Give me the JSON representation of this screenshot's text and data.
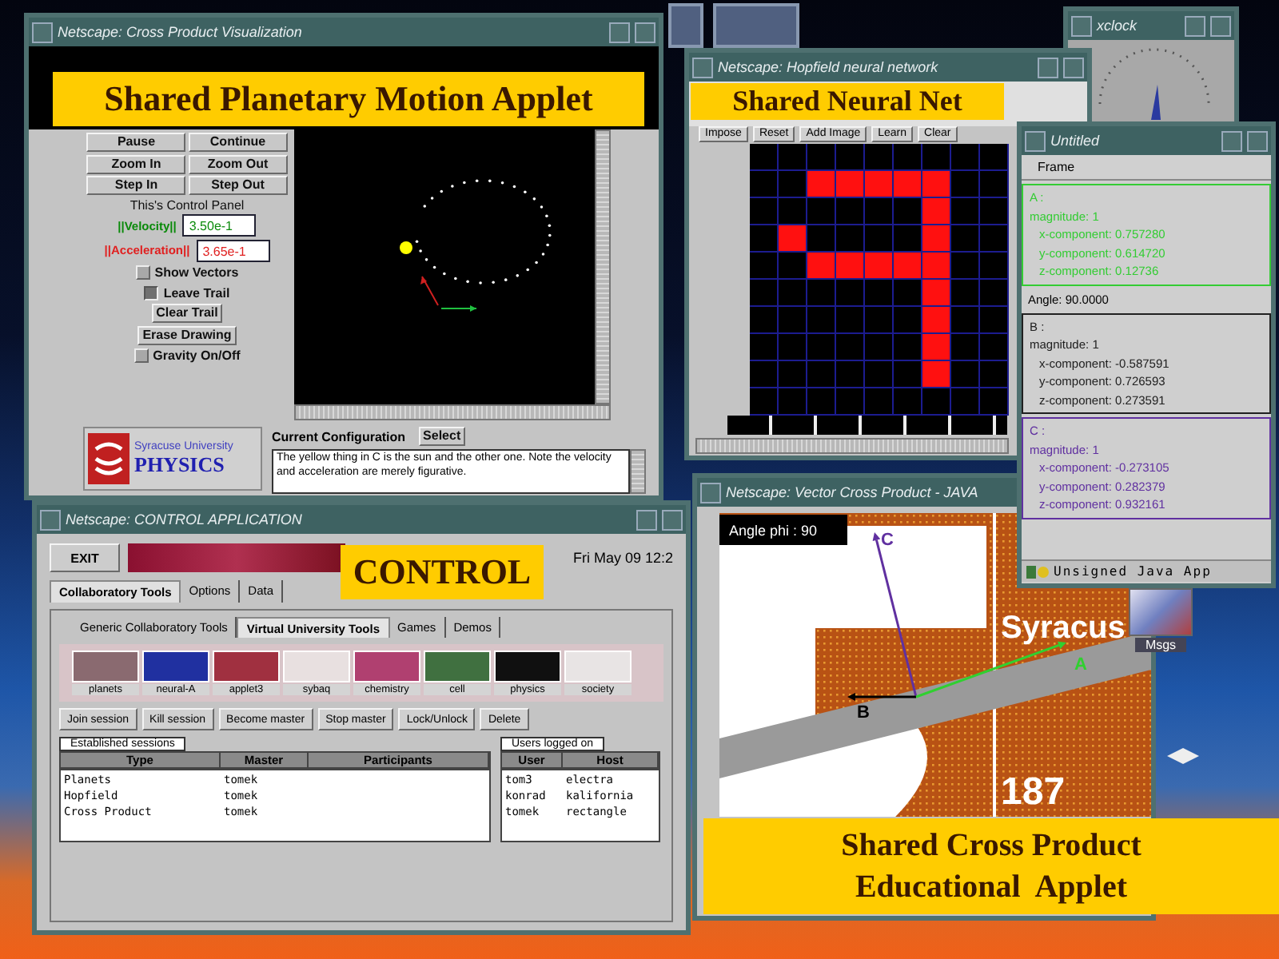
{
  "planetary_window": {
    "title": "Netscape: Cross Product Visualization",
    "banner": "Shared Planetary Motion Applet",
    "button_rows": [
      {
        "left": "Pause",
        "right": "Continue"
      },
      {
        "left": "Zoom In",
        "right": "Zoom Out"
      },
      {
        "left": "Step In",
        "right": "Step Out"
      }
    ],
    "panel_label": "This's Control Panel",
    "fields": [
      {
        "label": "||Velocity||",
        "value": "3.50e-1",
        "color": "#0a8a0a"
      },
      {
        "label": "||Acceleration||",
        "value": "3.65e-1",
        "color": "#e02020"
      }
    ],
    "options": [
      {
        "kind": "checkbox",
        "label": "Show Vectors",
        "checked": false
      },
      {
        "kind": "checkbox",
        "label": "Leave Trail",
        "checked": true
      },
      {
        "kind": "button",
        "label": "Clear Trail"
      },
      {
        "kind": "button",
        "label": "Erase Drawing"
      },
      {
        "kind": "checkbox",
        "label": "Gravity On/Off",
        "checked": false
      }
    ],
    "logo": {
      "line1": "Syracuse University",
      "line2": "PHYSICS"
    },
    "config_label": "Current Configuration",
    "select_button": "Select",
    "config_text": "The yellow thing in C is the sun and the other one. Note the velocity and acceleration are merely figurative."
  },
  "xclock_window": {
    "title": "xclock"
  },
  "neural_net_window": {
    "title": "Netscape: Hopfield neural network",
    "banner": "Shared Neural Net",
    "buttons": [
      "Impose",
      "Reset",
      "Add Image",
      "Learn",
      "Clear"
    ],
    "grid": [
      [
        false,
        false,
        false,
        false,
        false,
        false,
        false,
        false,
        false
      ],
      [
        false,
        false,
        true,
        true,
        true,
        true,
        true,
        false,
        false
      ],
      [
        false,
        false,
        false,
        false,
        false,
        false,
        true,
        false,
        false
      ],
      [
        false,
        true,
        false,
        false,
        false,
        false,
        true,
        false,
        false
      ],
      [
        false,
        false,
        true,
        true,
        true,
        true,
        true,
        false,
        false
      ],
      [
        false,
        false,
        false,
        false,
        false,
        false,
        true,
        false,
        false
      ],
      [
        false,
        false,
        false,
        false,
        false,
        false,
        true,
        false,
        false
      ],
      [
        false,
        false,
        false,
        false,
        false,
        false,
        true,
        false,
        false
      ],
      [
        false,
        false,
        false,
        false,
        false,
        false,
        true,
        false,
        false
      ],
      [
        false,
        false,
        false,
        false,
        false,
        false,
        false,
        false,
        false
      ]
    ]
  },
  "control_window": {
    "title": "Netscape: CONTROL APPLICATION",
    "banner": "CONTROL",
    "exit_button": "EXIT",
    "datetime": "Fri May 09 12:2",
    "tabs": [
      {
        "label": "Collaboratory Tools",
        "selected": true
      },
      {
        "label": "Options",
        "selected": false
      },
      {
        "label": "Data",
        "selected": false
      }
    ],
    "subtabs": [
      {
        "label": "Generic Collaboratory Tools",
        "selected": false
      },
      {
        "label": "Virtual University Tools",
        "selected": true
      },
      {
        "label": "Games",
        "selected": false
      },
      {
        "label": "Demos",
        "selected": false
      }
    ],
    "tools": [
      {
        "label": "planets",
        "color": "#8a6a70"
      },
      {
        "label": "neural-A",
        "color": "#2030a0"
      },
      {
        "label": "applet3",
        "color": "#a03040"
      },
      {
        "label": "sybaq",
        "color": "#e8e0e0"
      },
      {
        "label": "chemistry",
        "color": "#b04070"
      },
      {
        "label": "cell",
        "color": "#407040"
      },
      {
        "label": "physics",
        "color": "#101010"
      },
      {
        "label": "society",
        "color": "#e8e4e4"
      }
    ],
    "actions": [
      "Join session",
      "Kill session",
      "Become master",
      "Stop master",
      "Lock/Unlock",
      "Delete"
    ],
    "sessions_table": {
      "title": "Established sessions",
      "columns": [
        "Type",
        "Master",
        "Participants"
      ],
      "rows": [
        [
          "Planets",
          "tomek"
        ],
        [
          "Hopfield",
          "tomek"
        ],
        [
          "Cross Product",
          "tomek"
        ]
      ]
    },
    "users_table": {
      "title": "Users logged on",
      "columns": [
        "User",
        "Host"
      ],
      "rows": [
        [
          "tom3",
          "electra"
        ],
        [
          "konrad",
          "kalifornia"
        ],
        [
          "tomek",
          "rectangle"
        ]
      ]
    }
  },
  "cross_product_window": {
    "title": "Netscape: Vector Cross Product - JAVA",
    "banner_lines": [
      "Shared Cross Product",
      "Educational  Applet"
    ],
    "angle_label": "Angle phi : 90",
    "background_texts": [
      "Syracus",
      "187"
    ],
    "vectors": [
      {
        "label": "C",
        "color": "#6030a0"
      },
      {
        "label": "B",
        "color": "#000000"
      },
      {
        "label": "A",
        "color": "#30d030"
      }
    ]
  },
  "untitled_window": {
    "title": "Untitled",
    "menu": "Frame",
    "items": [
      {
        "kind": "vector",
        "color": "#33cc33",
        "lines": [
          "A :",
          "magnitude: 1",
          "x-component: 0.757280",
          "y-component: 0.614720",
          "z-component: 0.12736"
        ]
      },
      {
        "kind": "text",
        "text": "Angle: 90.0000"
      },
      {
        "kind": "vector",
        "color": "#202020",
        "lines": [
          "B :",
          "magnitude: 1",
          "x-component: -0.587591",
          "y-component: 0.726593",
          "z-component: 0.273591"
        ]
      },
      {
        "kind": "vector",
        "color": "#6030a0",
        "lines": [
          "C :",
          "magnitude: 1",
          "x-component: -0.273105",
          "y-component: 0.282379",
          "z-component: 0.932161"
        ]
      }
    ],
    "status": "Unsigned Java App"
  },
  "desktop": {
    "icons": [
      {
        "label": "Msgs"
      }
    ]
  }
}
